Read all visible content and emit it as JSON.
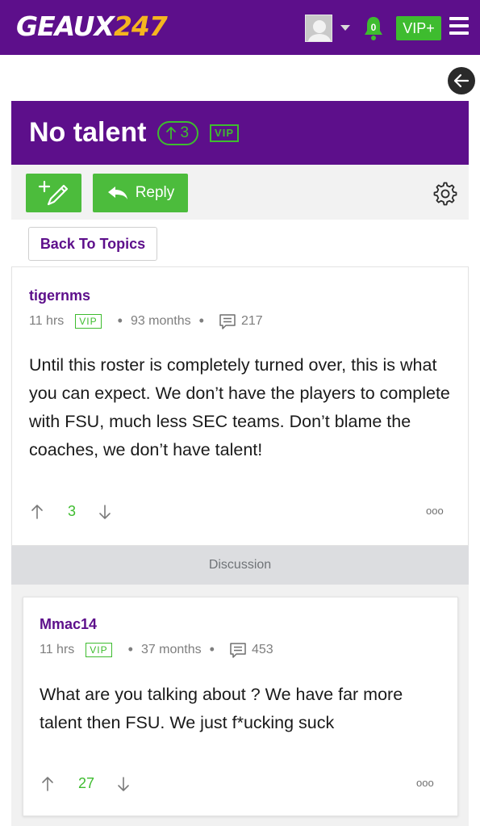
{
  "header": {
    "logo_white": "GEAUX",
    "logo_yellow": "247",
    "notification_count": "0",
    "vip_button_label": "VIP+"
  },
  "thread": {
    "title": "No talent",
    "upvotes": "3",
    "vip_tag": "VIP"
  },
  "toolbar": {
    "reply_label": "Reply"
  },
  "back_to_topics_label": "Back To Topics",
  "discussion_label": "Discussion",
  "posts": [
    {
      "username": "tigernms",
      "time": "11 hrs",
      "vip": "VIP",
      "membership": "93 months",
      "post_count": "217",
      "body": "Until this roster is completely turned over, this is what you can expect. We don’t have the players to complete with FSU, much less SEC teams. Don’t blame the coaches, we don’t have talent!",
      "votes": "3",
      "more": "ooo"
    },
    {
      "username": "Mmac14",
      "time": "11 hrs",
      "vip": "VIP",
      "membership": "37 months",
      "post_count": "453",
      "body": "What are you talking about ? We have far more talent then FSU. We just f*ucking suck",
      "votes": "27",
      "more": "ooo"
    }
  ],
  "colors": {
    "brand_purple": "#5d0f8b",
    "accent_green": "#3ebc2f",
    "logo_yellow": "#f5b51f"
  },
  "icons": [
    "avatar",
    "caret-down-icon",
    "bell-icon",
    "hamburger-menu-icon",
    "back-arrow-icon",
    "new-post-icon",
    "reply-arrow-icon",
    "gear-icon",
    "comment-icon",
    "upvote-arrow-icon",
    "downvote-arrow-icon",
    "more-options-icon"
  ]
}
